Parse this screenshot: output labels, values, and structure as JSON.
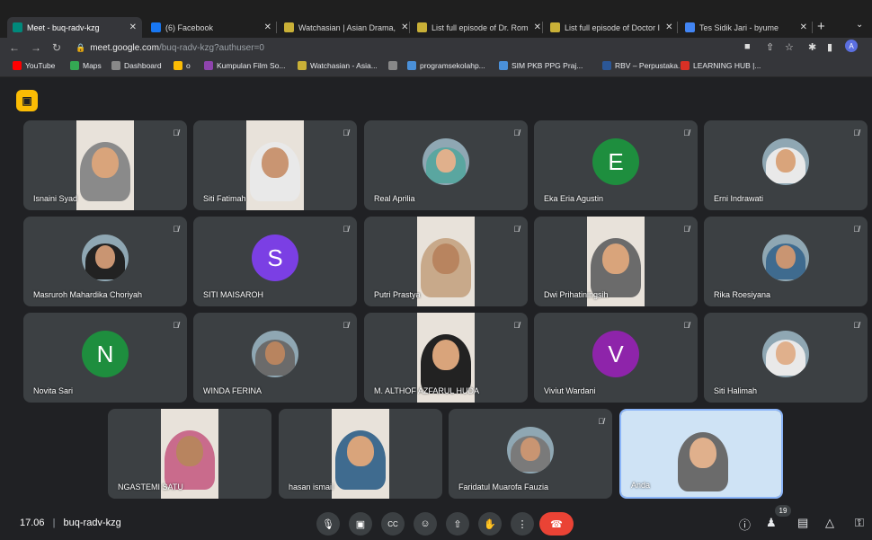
{
  "browser": {
    "tabs": [
      {
        "title": "Meet - buq-radv-kzg",
        "color": "#00897b",
        "active": true
      },
      {
        "title": "(6) Facebook",
        "color": "#1877f2",
        "active": false
      },
      {
        "title": "Watchasian | Asian Drama,",
        "color": "#c9b037",
        "active": false
      },
      {
        "title": "List full episode of Dr. Rom",
        "color": "#c9b037",
        "active": false
      },
      {
        "title": "List full episode of Doctor I",
        "color": "#c9b037",
        "active": false
      },
      {
        "title": "Tes Sidik Jari - byume",
        "color": "#4285f4",
        "active": false
      }
    ],
    "new_tab": "+",
    "url_host": "meet.google.com",
    "url_path": "/buq-radv-kzg?authuser=0",
    "profile_initial": "A",
    "bookmarks": [
      {
        "label": "YouTube",
        "color": "#ff0000"
      },
      {
        "label": "Maps",
        "color": "#34a853"
      },
      {
        "label": "Dashboard",
        "color": "#888888"
      },
      {
        "label": "o",
        "color": "#fbbc04"
      },
      {
        "label": "Kumpulan Film So...",
        "color": "#8e44ad"
      },
      {
        "label": "Watchasian - Asia...",
        "color": "#c9b037"
      },
      {
        "label": "",
        "color": "#888888"
      },
      {
        "label": "programsekolahp...",
        "color": "#4a90d9"
      },
      {
        "label": "SIM PKB PPG Praj...",
        "color": "#4a90d9"
      },
      {
        "label": "RBV – Perpustaka...",
        "color": "#2b5797"
      },
      {
        "label": "LEARNING HUB |...",
        "color": "#d93025"
      }
    ]
  },
  "meet": {
    "time": "17.06",
    "code": "buq-radv-kzg",
    "participant_count": "19",
    "participants": [
      {
        "name": "Isnaini Syad",
        "kind": "video"
      },
      {
        "name": "Siti Fatimah",
        "kind": "video"
      },
      {
        "name": "Real Aprilia",
        "kind": "photo"
      },
      {
        "name": "Eka Eria Agustin",
        "kind": "letter",
        "letter": "E",
        "color": "#1e8e3e"
      },
      {
        "name": "Erni Indrawati",
        "kind": "photo"
      },
      {
        "name": "Masruroh Mahardika Choriyah",
        "kind": "photo"
      },
      {
        "name": "SITI MAISAROH",
        "kind": "letter",
        "letter": "S",
        "color": "#7b3fe4"
      },
      {
        "name": "Putri Prastya",
        "kind": "video"
      },
      {
        "name": "Dwi Prihatiningsih",
        "kind": "video"
      },
      {
        "name": "Rika Roesiyana",
        "kind": "photo"
      },
      {
        "name": "Novita Sari",
        "kind": "letter",
        "letter": "N",
        "color": "#1e8e3e"
      },
      {
        "name": "WINDA FERINA",
        "kind": "photo"
      },
      {
        "name": "M. ALTHOF AZFARUL HUDA",
        "kind": "video"
      },
      {
        "name": "Viviut Wardani",
        "kind": "letter",
        "letter": "V",
        "color": "#8e24aa"
      },
      {
        "name": "Siti Halimah",
        "kind": "photo"
      },
      {
        "name": "NGASTEMI SATU",
        "kind": "video"
      },
      {
        "name": "hasan ismail",
        "kind": "video"
      },
      {
        "name": "Faridatul Muarofa Fauzia",
        "kind": "photo"
      },
      {
        "name": "Anda",
        "kind": "self"
      }
    ]
  }
}
